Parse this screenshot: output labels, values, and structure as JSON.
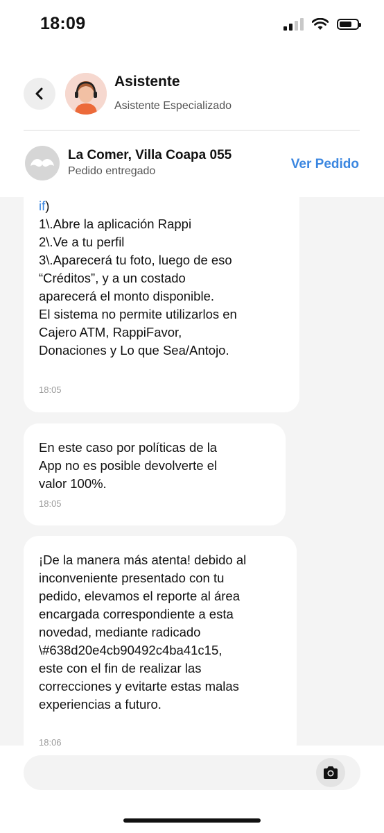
{
  "status_bar": {
    "time": "18:09",
    "icons": [
      "signal-icon",
      "wifi-icon",
      "battery-icon"
    ]
  },
  "header": {
    "back_icon": "chevron-left-icon",
    "agent_name": "Asistente",
    "agent_role": "Asistente Especializado"
  },
  "order": {
    "store_name": "La Comer, Villa Coapa 055",
    "status": "Pedido entregado",
    "view_order_label": "Ver Pedido",
    "accent_color": "#3a86e0"
  },
  "messages": [
    {
      "link_prefix": "if",
      "text": ")\n1\\.Abre la aplicación Rappi\n2\\.Ve a tu perfil\n3\\.Aparecerá tu foto, luego de eso\n“Créditos”, y a un costado\naparecerá el monto disponible.\nEl sistema no permite utilizarlos en\nCajero ATM, RappiFavor,\nDonaciones y Lo que Sea/Antojo.",
      "time": "18:05"
    },
    {
      "text": "En este caso por políticas de la\nApp no es posible devolverte el\nvalor 100%.",
      "time": "18:05"
    },
    {
      "text": "¡De la manera más atenta! debido al\ninconveniente presentado con tu\npedido, elevamos el reporte al área\nencargada correspondiente a esta\nnovedad, mediante radicado\n\\#638d20e4cb90492c4ba41c15,\neste con el fin de realizar las\ncorrecciones y evitarte estas malas\nexperiencias a futuro.",
      "time": "18:06"
    }
  ],
  "composer": {
    "placeholder": "",
    "camera_icon": "camera-icon"
  }
}
